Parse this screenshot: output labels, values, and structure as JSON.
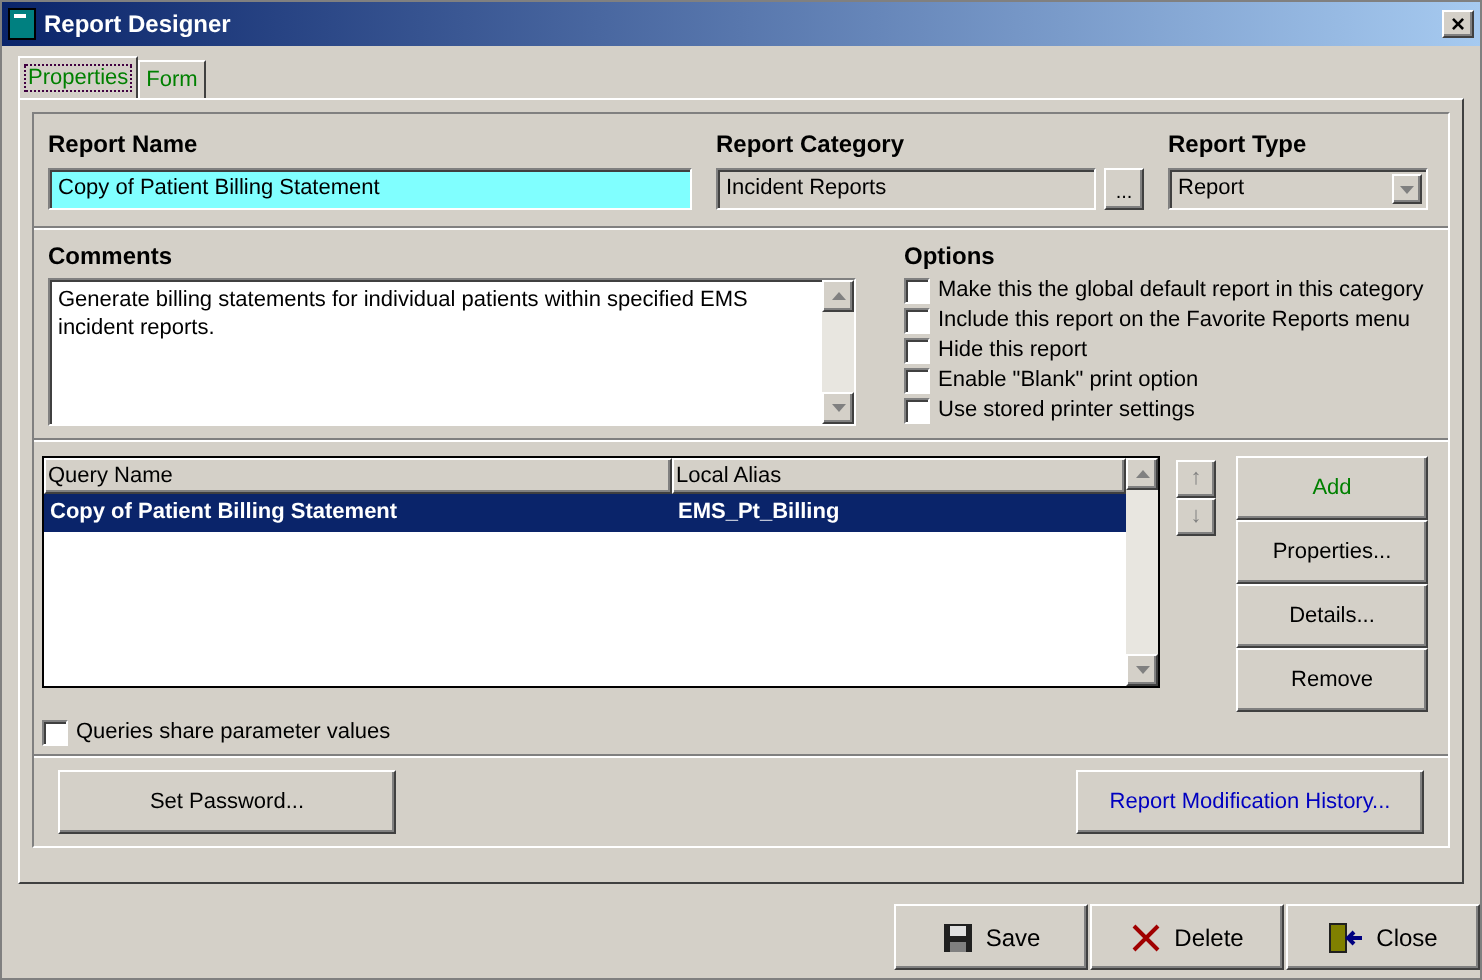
{
  "window": {
    "title": "Report Designer",
    "close": "×"
  },
  "tabs": [
    {
      "label": "Properties",
      "selected": true
    },
    {
      "label": "Form",
      "selected": false
    }
  ],
  "report_name": {
    "label": "Report Name",
    "value": "Copy of Patient Billing Statement"
  },
  "report_category": {
    "label": "Report Category",
    "value": "Incident Reports",
    "browse": "..."
  },
  "report_type": {
    "label": "Report Type",
    "value": "Report"
  },
  "comments": {
    "label": "Comments",
    "value": "Generate billing statements for individual patients within specified EMS incident reports."
  },
  "options": {
    "label": "Options",
    "items": [
      {
        "label": "Make this the global default report in this category",
        "checked": false
      },
      {
        "label": "Include this report on the Favorite Reports menu",
        "checked": false
      },
      {
        "label": "Hide this report",
        "checked": false
      },
      {
        "label": "Enable \"Blank\" print option",
        "checked": false
      },
      {
        "label": "Use stored printer settings",
        "checked": false
      }
    ]
  },
  "queries": {
    "columns": [
      "Query Name",
      "Local Alias"
    ],
    "rows": [
      {
        "cells": [
          "Copy of Patient Billing Statement",
          "EMS_Pt_Billing"
        ],
        "selected": true
      }
    ]
  },
  "move_buttons": [
    "↑",
    "↓"
  ],
  "query_buttons": [
    {
      "label": "Add",
      "kind": "primary"
    },
    {
      "label": "Properties...",
      "kind": "normal"
    },
    {
      "label": "Details...",
      "kind": "normal"
    },
    {
      "label": "Remove",
      "kind": "normal"
    }
  ],
  "share_parameters": {
    "label": "Queries share parameter values",
    "checked": false
  },
  "set_password": "Set Password...",
  "modification_history": "Report Modification History...",
  "footer_buttons": [
    {
      "label": "Save",
      "kind": "save"
    },
    {
      "label": "Delete",
      "kind": "delete"
    },
    {
      "label": "Close",
      "kind": "close"
    }
  ]
}
